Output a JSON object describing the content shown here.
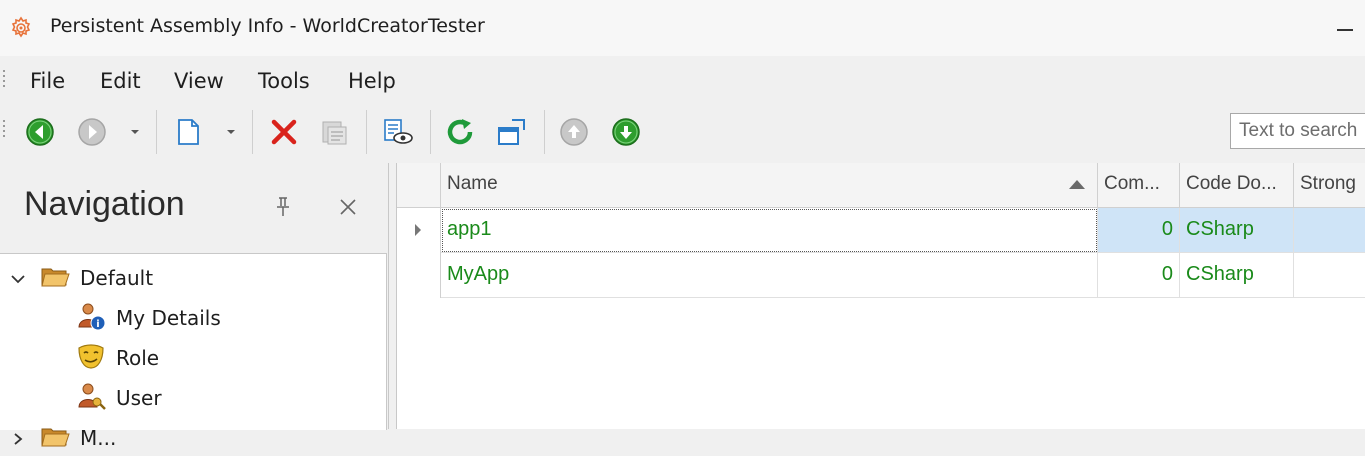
{
  "window": {
    "title": "Persistent Assembly Info - WorldCreatorTester",
    "app_icon": "gear-network-icon"
  },
  "menu": {
    "items": [
      "File",
      "Edit",
      "View",
      "Tools",
      "Help"
    ]
  },
  "toolbar": {
    "buttons": [
      "back-icon",
      "forward-icon",
      "new-object-icon",
      "delete-icon",
      "delete-disabled-icon",
      "show-in-view-icon",
      "refresh-icon",
      "open-window-icon",
      "move-up-icon",
      "move-down-icon"
    ],
    "search_placeholder": "Text to search"
  },
  "navigation": {
    "title": "Navigation",
    "groups": [
      {
        "label": "Default",
        "expanded": true,
        "items": [
          {
            "label": "My Details",
            "icon": "user-info-icon"
          },
          {
            "label": "Role",
            "icon": "role-mask-icon"
          },
          {
            "label": "User",
            "icon": "user-key-icon"
          }
        ]
      },
      {
        "label": "M...",
        "expanded": false,
        "items": []
      }
    ]
  },
  "grid": {
    "columns": [
      "Name",
      "Com...",
      "Code Do...",
      "Strong"
    ],
    "sort": {
      "column": "Name",
      "direction": "ascending"
    },
    "rows": [
      {
        "name": "app1",
        "com": "0",
        "code_dom": "CSharp",
        "strong": "",
        "selected": true
      },
      {
        "name": "MyApp",
        "com": "0",
        "code_dom": "CSharp",
        "strong": "",
        "selected": false
      }
    ]
  },
  "colors": {
    "accent_text": "#1a8a1a",
    "selection": "#cfe4f7"
  }
}
